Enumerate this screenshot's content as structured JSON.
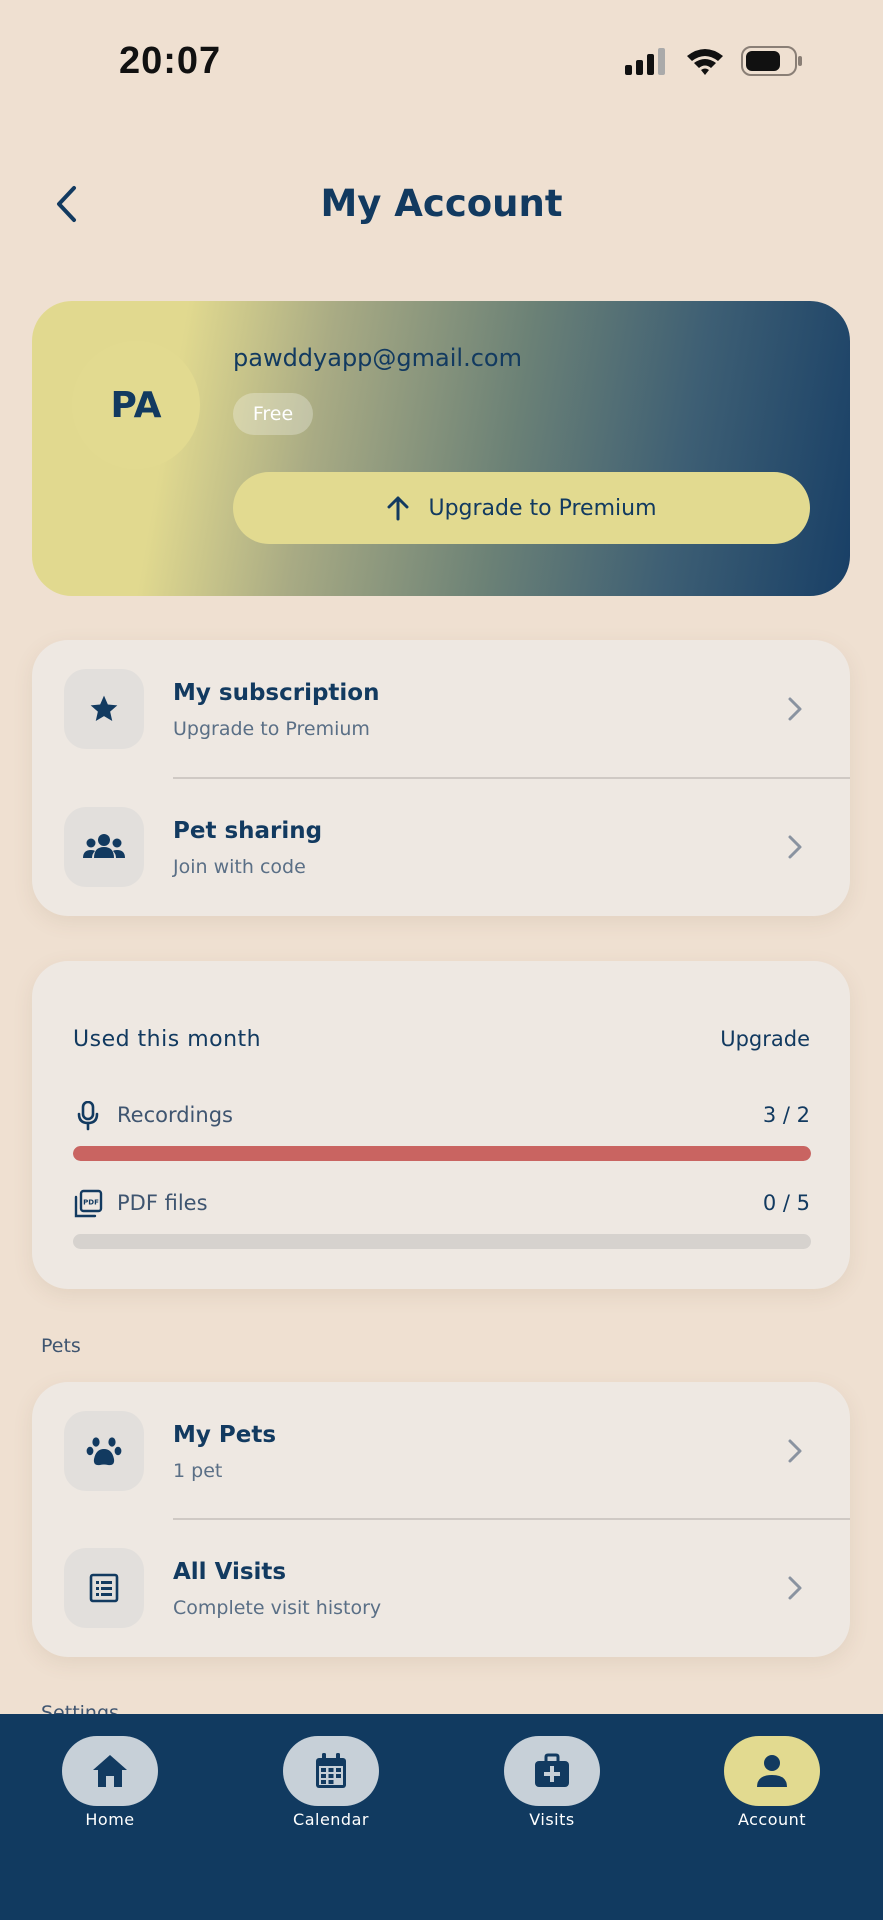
{
  "status_bar": {
    "time": "20:07"
  },
  "header": {
    "title": "My Account"
  },
  "profile": {
    "initials": "PA",
    "email": "pawddyapp@gmail.com",
    "plan": "Free",
    "upgrade_label": "Upgrade to Premium"
  },
  "account_menu": [
    {
      "title": "My subscription",
      "subtitle": "Upgrade to Premium",
      "icon": "star-icon"
    },
    {
      "title": "Pet sharing",
      "subtitle": "Join with code",
      "icon": "people-group-icon"
    }
  ],
  "usage": {
    "title": "Used this month",
    "upgrade_link": "Upgrade",
    "items": [
      {
        "label": "Recordings",
        "count": "3 / 2",
        "used": 3,
        "limit": 2,
        "fill_fraction": 1.0,
        "color": "#c96461",
        "icon": "microphone-icon"
      },
      {
        "label": "PDF files",
        "count": "0 / 5",
        "used": 0,
        "limit": 5,
        "fill_fraction": 0.0,
        "color": "#d6d2ce",
        "icon": "pdf-files-icon"
      }
    ]
  },
  "sections": {
    "pets": "Pets",
    "settings": "Settings"
  },
  "pets_menu": [
    {
      "title": "My Pets",
      "subtitle": "1 pet",
      "icon": "paw-icon"
    },
    {
      "title": "All Visits",
      "subtitle": "Complete visit history",
      "icon": "list-icon"
    }
  ],
  "bottom_nav": [
    {
      "label": "Home",
      "icon": "home-icon",
      "active": false
    },
    {
      "label": "Calendar",
      "icon": "calendar-icon",
      "active": false
    },
    {
      "label": "Visits",
      "icon": "medical-bag-icon",
      "active": false
    },
    {
      "label": "Account",
      "icon": "person-icon",
      "active": true
    }
  ],
  "colors": {
    "background": "#efe0d1",
    "primary": "#123a60",
    "accent": "#e2da90",
    "over_limit": "#c96461",
    "nav_background": "#113a60"
  }
}
